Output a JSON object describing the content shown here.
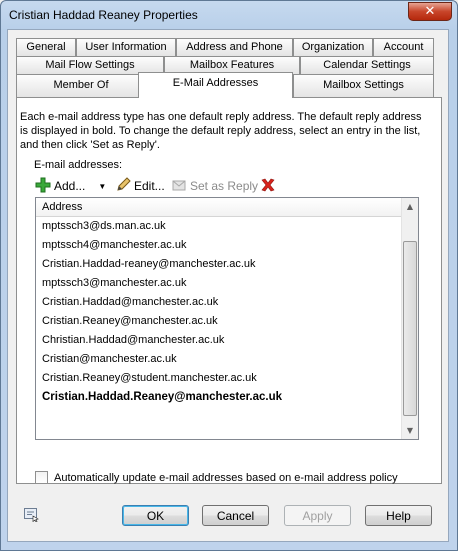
{
  "window": {
    "title": "Cristian Haddad Reaney Properties",
    "close_label": "✕"
  },
  "tabs": {
    "row1": [
      "General",
      "User Information",
      "Address and Phone",
      "Organization",
      "Account"
    ],
    "row2": [
      "Mail Flow Settings",
      "Mailbox Features",
      "Calendar Settings"
    ],
    "row3": [
      "Member Of",
      "E-Mail Addresses",
      "Mailbox Settings"
    ],
    "active": "E-Mail Addresses"
  },
  "description": "Each e-mail address type has one default reply address. The default reply address is displayed in bold. To change the default reply address, select an entry in the list, and then click 'Set as Reply'.",
  "emails_label": "E-mail addresses:",
  "toolbar": {
    "add_label": "Add...",
    "edit_label": "Edit...",
    "set_reply_label": "Set as Reply"
  },
  "list": {
    "header": "Address",
    "rows": [
      "mptssch3@ds.man.ac.uk",
      "mptssch4@manchester.ac.uk",
      "Cristian.Haddad-reaney@manchester.ac.uk",
      "mptssch3@manchester.ac.uk",
      "Cristian.Haddad@manchester.ac.uk",
      "Cristian.Reaney@manchester.ac.uk",
      "Christian.Haddad@manchester.ac.uk",
      "Cristian@manchester.ac.uk",
      "Cristian.Reaney@student.manchester.ac.uk"
    ],
    "bold_row": "Cristian.Haddad.Reaney@manchester.ac.uk"
  },
  "checkbox": {
    "label": "Automatically update e-mail addresses based on e-mail address policy",
    "checked": false
  },
  "buttons": {
    "ok": "OK",
    "cancel": "Cancel",
    "apply": "Apply",
    "help": "Help"
  }
}
